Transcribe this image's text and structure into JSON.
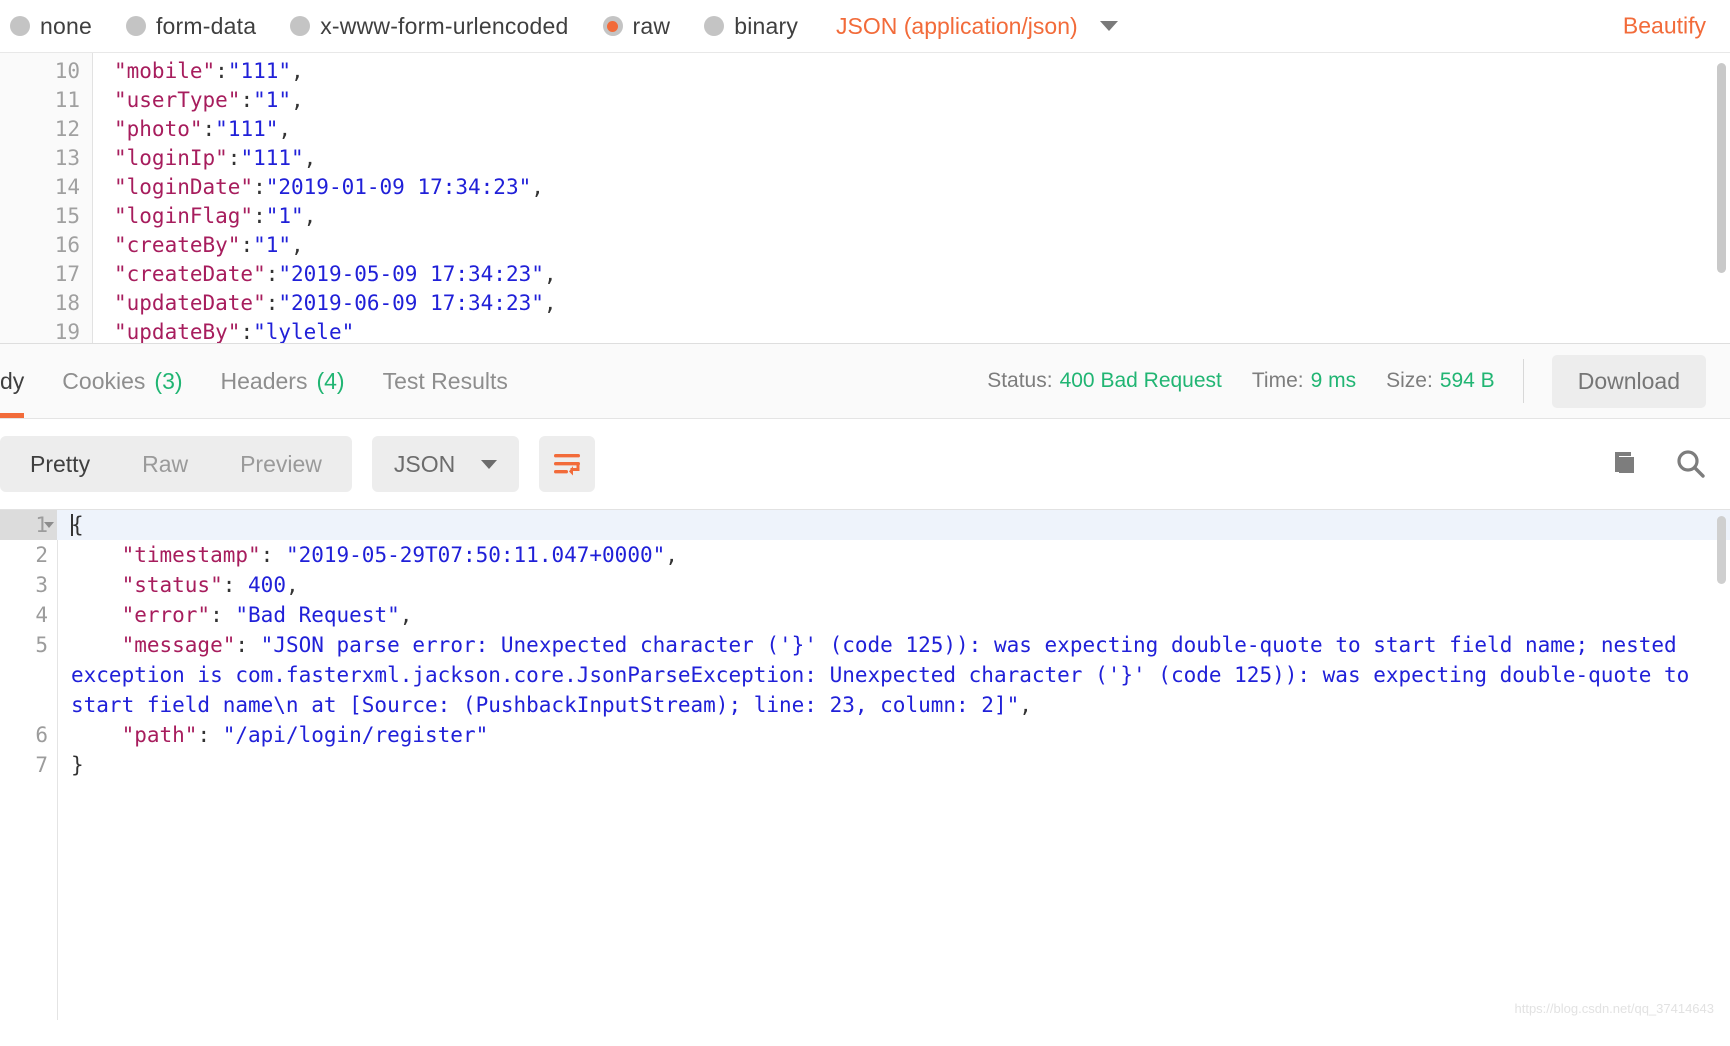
{
  "body_type_bar": {
    "options": [
      {
        "label": "none",
        "selected": false
      },
      {
        "label": "form-data",
        "selected": false
      },
      {
        "label": "x-www-form-urlencoded",
        "selected": false
      },
      {
        "label": "raw",
        "selected": true
      },
      {
        "label": "binary",
        "selected": false
      }
    ],
    "content_type": "JSON (application/json)",
    "beautify_label": "Beautify"
  },
  "request_editor": {
    "lines": [
      {
        "num": "10",
        "segments": [
          {
            "t": "\"mobile\"",
            "c": "k"
          },
          {
            "t": ":",
            "c": "p"
          },
          {
            "t": "\"111\"",
            "c": "s"
          },
          {
            "t": ",",
            "c": "p"
          }
        ]
      },
      {
        "num": "11",
        "segments": [
          {
            "t": "\"userType\"",
            "c": "k"
          },
          {
            "t": ":",
            "c": "p"
          },
          {
            "t": "\"1\"",
            "c": "s"
          },
          {
            "t": ",",
            "c": "p"
          }
        ]
      },
      {
        "num": "12",
        "segments": [
          {
            "t": "\"photo\"",
            "c": "k"
          },
          {
            "t": ":",
            "c": "p"
          },
          {
            "t": "\"111\"",
            "c": "s"
          },
          {
            "t": ",",
            "c": "p"
          }
        ]
      },
      {
        "num": "13",
        "segments": [
          {
            "t": "\"loginIp\"",
            "c": "k"
          },
          {
            "t": ":",
            "c": "p"
          },
          {
            "t": "\"111\"",
            "c": "s"
          },
          {
            "t": ",",
            "c": "p"
          }
        ]
      },
      {
        "num": "14",
        "segments": [
          {
            "t": "\"loginDate\"",
            "c": "k"
          },
          {
            "t": ":",
            "c": "p"
          },
          {
            "t": "\"2019-01-09 17:34:23\"",
            "c": "s"
          },
          {
            "t": ",",
            "c": "p"
          }
        ]
      },
      {
        "num": "15",
        "segments": [
          {
            "t": "\"loginFlag\"",
            "c": "k"
          },
          {
            "t": ":",
            "c": "p"
          },
          {
            "t": "\"1\"",
            "c": "s"
          },
          {
            "t": ",",
            "c": "p"
          }
        ]
      },
      {
        "num": "16",
        "segments": [
          {
            "t": "\"createBy\"",
            "c": "k"
          },
          {
            "t": ":",
            "c": "p"
          },
          {
            "t": "\"1\"",
            "c": "s"
          },
          {
            "t": ",",
            "c": "p"
          }
        ]
      },
      {
        "num": "17",
        "segments": [
          {
            "t": "\"createDate\"",
            "c": "k"
          },
          {
            "t": ":",
            "c": "p"
          },
          {
            "t": "\"2019-05-09 17:34:23\"",
            "c": "s"
          },
          {
            "t": ",",
            "c": "p"
          }
        ]
      },
      {
        "num": "18",
        "segments": [
          {
            "t": "\"updateDate\"",
            "c": "k"
          },
          {
            "t": ":",
            "c": "p"
          },
          {
            "t": "\"2019-06-09 17:34:23\"",
            "c": "s"
          },
          {
            "t": ",",
            "c": "p"
          }
        ]
      },
      {
        "num": "19",
        "segments": [
          {
            "t": "\"updateBy\"",
            "c": "k"
          },
          {
            "t": ":",
            "c": "p"
          },
          {
            "t": "\"lylele\"",
            "c": "s"
          }
        ]
      }
    ]
  },
  "response_meta": {
    "tabs": [
      {
        "label": "dy",
        "count": "",
        "active": true
      },
      {
        "label": "Cookies",
        "count": "(3)",
        "active": false
      },
      {
        "label": "Headers",
        "count": "(4)",
        "active": false
      },
      {
        "label": "Test Results",
        "count": "",
        "active": false
      }
    ],
    "status_label": "Status:",
    "status_value": "400 Bad Request",
    "time_label": "Time:",
    "time_value": "9 ms",
    "size_label": "Size:",
    "size_value": "594 B",
    "download_label": "Download"
  },
  "response_toolbar": {
    "view_modes": [
      {
        "label": "Pretty",
        "active": true
      },
      {
        "label": "Raw",
        "active": false
      },
      {
        "label": "Preview",
        "active": false
      }
    ],
    "format": "JSON"
  },
  "response_body": {
    "lines": [
      {
        "num": "1",
        "foldable": true,
        "highlight": true,
        "cursor": true,
        "segments": [
          {
            "t": "{",
            "c": "p"
          }
        ]
      },
      {
        "num": "2",
        "foldable": false,
        "highlight": false,
        "indent": "    ",
        "segments": [
          {
            "t": "\"timestamp\"",
            "c": "k"
          },
          {
            "t": ": ",
            "c": "p"
          },
          {
            "t": "\"2019-05-29T07:50:11.047+0000\"",
            "c": "s"
          },
          {
            "t": ",",
            "c": "p"
          }
        ]
      },
      {
        "num": "3",
        "foldable": false,
        "highlight": false,
        "indent": "    ",
        "segments": [
          {
            "t": "\"status\"",
            "c": "k"
          },
          {
            "t": ": ",
            "c": "p"
          },
          {
            "t": "400",
            "c": "s"
          },
          {
            "t": ",",
            "c": "p"
          }
        ]
      },
      {
        "num": "4",
        "foldable": false,
        "highlight": false,
        "indent": "    ",
        "segments": [
          {
            "t": "\"error\"",
            "c": "k"
          },
          {
            "t": ": ",
            "c": "p"
          },
          {
            "t": "\"Bad Request\"",
            "c": "s"
          },
          {
            "t": ",",
            "c": "p"
          }
        ]
      },
      {
        "num": "5",
        "foldable": false,
        "highlight": false,
        "indent": "    ",
        "segments": [
          {
            "t": "\"message\"",
            "c": "k"
          },
          {
            "t": ": ",
            "c": "p"
          },
          {
            "t": "\"JSON parse error: Unexpected character ('}' (code 125)): was expecting double-quote to start field name; nested exception is com.fasterxml.jackson.core.JsonParseException: Unexpected character ('}' (code 125)): was expecting double-quote to start field name\\n at [Source: (PushbackInputStream); line: 23, column: 2]\"",
            "c": "s"
          },
          {
            "t": ",",
            "c": "p"
          }
        ]
      },
      {
        "num": "6",
        "foldable": false,
        "highlight": false,
        "indent": "    ",
        "segments": [
          {
            "t": "\"path\"",
            "c": "k"
          },
          {
            "t": ": ",
            "c": "p"
          },
          {
            "t": "\"/api/login/register\"",
            "c": "s"
          }
        ]
      },
      {
        "num": "7",
        "foldable": false,
        "highlight": false,
        "segments": [
          {
            "t": "}",
            "c": "p"
          }
        ]
      }
    ]
  },
  "icons": {
    "copy": "copy-icon",
    "search": "search-icon",
    "wrap": "word-wrap-icon"
  },
  "colors": {
    "accent": "#f26b3a",
    "success": "#21b573",
    "key": "#a71d5d",
    "string": "#2020d8"
  }
}
